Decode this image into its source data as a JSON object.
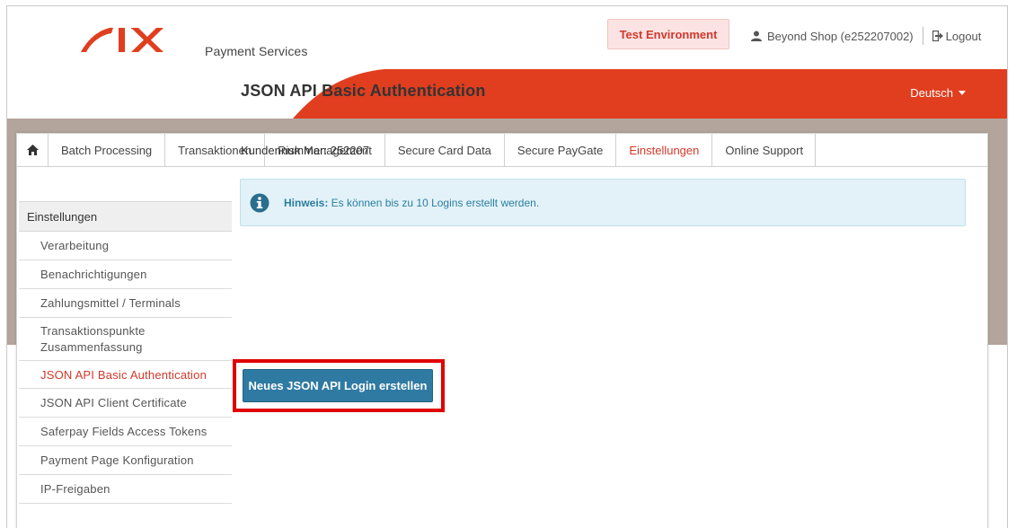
{
  "header": {
    "brand_name": "SIX",
    "brand_sub": "Payment Services",
    "environment_badge": "Test Environment",
    "user": "Beyond Shop (e252207002)",
    "logout": "Logout",
    "language": "Deutsch",
    "brand_color": "#e03e1f"
  },
  "nav": {
    "home_icon": "home-icon",
    "tabs": [
      {
        "label": "Batch Processing"
      },
      {
        "label": "Transaktionen"
      },
      {
        "label": "Risk Management"
      },
      {
        "label": "Secure Card Data"
      },
      {
        "label": "Secure PayGate"
      },
      {
        "label": "Einstellungen",
        "active": true
      },
      {
        "label": "Online Support"
      }
    ]
  },
  "sidebar": {
    "heading": "Einstellungen",
    "items": [
      {
        "label": "Verarbeitung"
      },
      {
        "label": "Benachrichtigungen"
      },
      {
        "label": "Zahlungsmittel / Terminals"
      },
      {
        "label": "Transaktionspunkte Zusammenfassung"
      },
      {
        "label": "JSON API Basic Authentication",
        "active": true
      },
      {
        "label": "JSON API Client Certificate"
      },
      {
        "label": "Saferpay Fields Access Tokens"
      },
      {
        "label": "Payment Page Konfiguration"
      },
      {
        "label": "IP-Freigaben"
      }
    ]
  },
  "main": {
    "title": "JSON API Basic Authentication",
    "customer_number": "Kundennummer: 252207",
    "note_label": "Hinweis:",
    "note_text": " Es können bis zu 10 Logins erstellt werden.",
    "create_button": "Neues JSON API Login erstellen"
  },
  "colors": {
    "accent_red": "#d2382b",
    "button_blue": "#2f7aa3",
    "info_bg": "#e3f2f8",
    "gray_band": "#b3a59c",
    "highlight": "#e00000"
  }
}
